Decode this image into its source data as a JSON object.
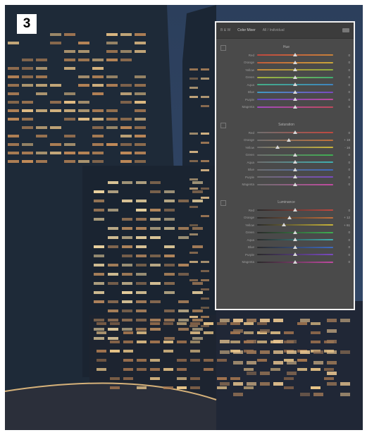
{
  "step_number": "3",
  "panel": {
    "tabs": [
      "B & W",
      "Color Mixer",
      "All / Individual"
    ],
    "active_tab": 1,
    "sections": [
      {
        "key": "hue",
        "title": "Hue",
        "rows": [
          {
            "label": "Red",
            "value": "0",
            "pos": 0.5,
            "grad": [
              "#c0483f",
              "#c8823a"
            ]
          },
          {
            "label": "Orange",
            "value": "0",
            "pos": 0.5,
            "grad": [
              "#c25a3a",
              "#c9a63a"
            ]
          },
          {
            "label": "Yellow",
            "value": "0",
            "pos": 0.5,
            "grad": [
              "#c8893a",
              "#8fb03c"
            ]
          },
          {
            "label": "Green",
            "value": "0",
            "pos": 0.5,
            "grad": [
              "#a8b03c",
              "#3fae72"
            ]
          },
          {
            "label": "Aqua",
            "value": "0",
            "pos": 0.5,
            "grad": [
              "#44ae86",
              "#3f84c0"
            ]
          },
          {
            "label": "Blue",
            "value": "0",
            "pos": 0.5,
            "grad": [
              "#3f9ac0",
              "#7a4ac0"
            ]
          },
          {
            "label": "Purple",
            "value": "0",
            "pos": 0.5,
            "grad": [
              "#5b4ac0",
              "#c04aa0"
            ]
          },
          {
            "label": "Magenta",
            "value": "0",
            "pos": 0.5,
            "grad": [
              "#a04ac0",
              "#c04a5c"
            ]
          }
        ]
      },
      {
        "key": "saturation",
        "title": "Saturation",
        "rows": [
          {
            "label": "Red",
            "value": "0",
            "pos": 0.5,
            "grad": [
              "#6e6e6e",
              "#c0483f"
            ]
          },
          {
            "label": "Orange",
            "value": "+ 18",
            "pos": 0.42,
            "grad": [
              "#6e6e6e",
              "#c2703a"
            ]
          },
          {
            "label": "Yellow",
            "value": "- 16",
            "pos": 0.27,
            "grad": [
              "#6e6e6e",
              "#c8b43a"
            ]
          },
          {
            "label": "Green",
            "value": "0",
            "pos": 0.5,
            "grad": [
              "#6e6e6e",
              "#3fae52"
            ]
          },
          {
            "label": "Aqua",
            "value": "0",
            "pos": 0.5,
            "grad": [
              "#6e6e6e",
              "#3fb0b0"
            ]
          },
          {
            "label": "Blue",
            "value": "0",
            "pos": 0.5,
            "grad": [
              "#6e6e6e",
              "#3f6ac0"
            ]
          },
          {
            "label": "Purple",
            "value": "0",
            "pos": 0.5,
            "grad": [
              "#6e6e6e",
              "#7a4ac0"
            ]
          },
          {
            "label": "Magenta",
            "value": "0",
            "pos": 0.5,
            "grad": [
              "#6e6e6e",
              "#c04aa0"
            ]
          }
        ]
      },
      {
        "key": "luminance",
        "title": "Luminance",
        "rows": [
          {
            "label": "Red",
            "value": "0",
            "pos": 0.5,
            "grad": [
              "#2a2a2a",
              "#c0483f"
            ]
          },
          {
            "label": "Orange",
            "value": "+ 12",
            "pos": 0.43,
            "grad": [
              "#2a2a2a",
              "#c2703a"
            ]
          },
          {
            "label": "Yellow",
            "value": "+ 61",
            "pos": 0.35,
            "grad": [
              "#2a2a2a",
              "#c8b43a"
            ]
          },
          {
            "label": "Green",
            "value": "0",
            "pos": 0.5,
            "grad": [
              "#2a2a2a",
              "#3fae52"
            ]
          },
          {
            "label": "Aqua",
            "value": "0",
            "pos": 0.5,
            "grad": [
              "#2a2a2a",
              "#3fb0b0"
            ]
          },
          {
            "label": "Blue",
            "value": "0",
            "pos": 0.5,
            "grad": [
              "#2a2a2a",
              "#3f6ac0"
            ]
          },
          {
            "label": "Purple",
            "value": "0",
            "pos": 0.5,
            "grad": [
              "#2a2a2a",
              "#7a4ac0"
            ]
          },
          {
            "label": "Magenta",
            "value": "0",
            "pos": 0.5,
            "grad": [
              "#2a2a2a",
              "#c04aa0"
            ]
          }
        ]
      }
    ]
  }
}
